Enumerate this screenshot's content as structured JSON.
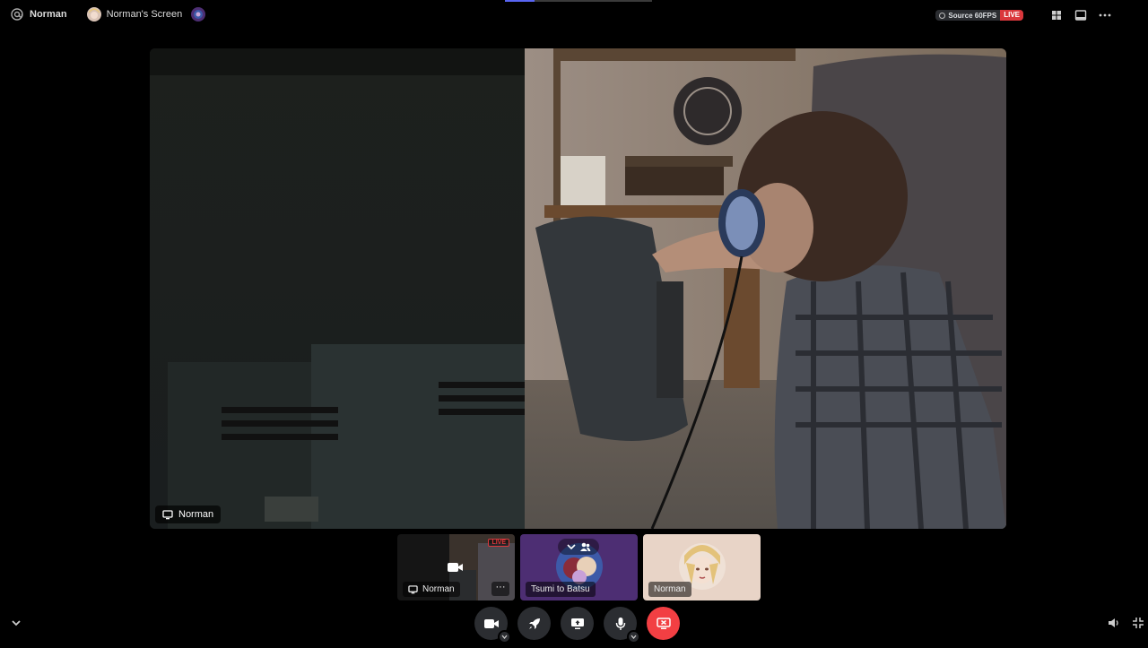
{
  "topbar": {
    "user_name": "Norman",
    "screen_title": "Norman's Screen",
    "quality_label": "Source 60FPS",
    "live_label": "LIVE",
    "icons": [
      "at-icon",
      "grid-layout-icon",
      "popout-icon",
      "more-icon"
    ]
  },
  "stream": {
    "owner_label": "Norman",
    "icon": "monitor-icon"
  },
  "thumbnails": [
    {
      "label": "Norman",
      "badge": "LIVE",
      "more": "···",
      "icon": "monitor-icon"
    },
    {
      "label": "Tsumi to Batsu",
      "icon": "group-icon"
    },
    {
      "label": "Norman"
    }
  ],
  "controls": [
    {
      "name": "camera",
      "icon": "camera-icon",
      "has_menu": true
    },
    {
      "name": "activity",
      "icon": "rocket-icon",
      "has_menu": false
    },
    {
      "name": "share-screen",
      "icon": "screen-share-icon",
      "has_menu": false
    },
    {
      "name": "microphone",
      "icon": "microphone-icon",
      "has_menu": true
    },
    {
      "name": "stop-stream",
      "icon": "stop-stream-icon",
      "has_menu": false
    }
  ],
  "colors": {
    "live_red": "#da373c",
    "stop_red": "#f23f43",
    "button_gray": "#2b2d31",
    "group_purple": "#4d2e73",
    "progress_blue": "#5865f2"
  },
  "stream_progress": 0.2
}
